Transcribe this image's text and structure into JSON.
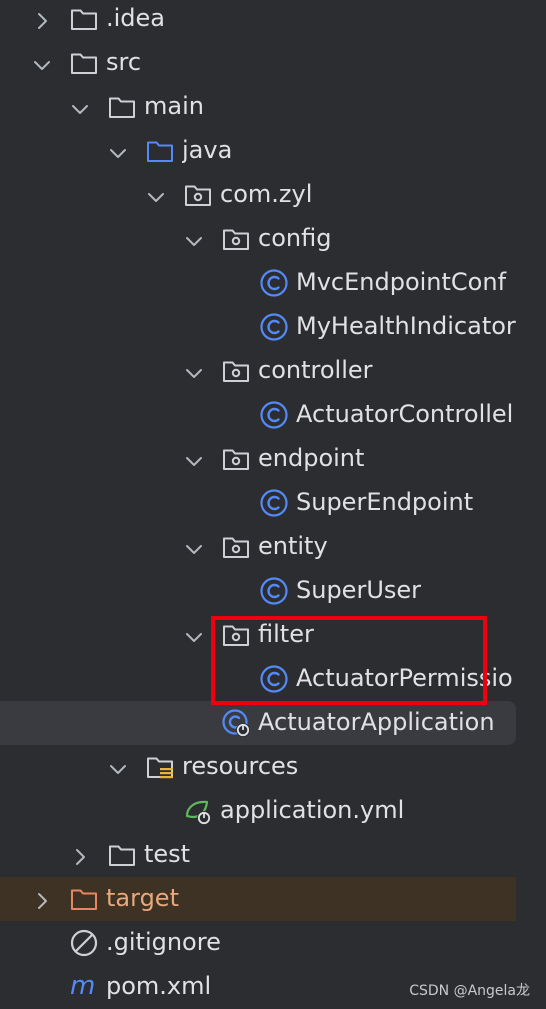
{
  "tree": {
    "items": [
      {
        "label": ".idea",
        "icon": "folder-icon",
        "chevron": "right",
        "level": 1
      },
      {
        "label": "src",
        "icon": "folder-icon",
        "chevron": "down",
        "level": 1
      },
      {
        "label": "main",
        "icon": "folder-icon",
        "chevron": "down",
        "level": 2
      },
      {
        "label": "java",
        "icon": "source-folder-icon",
        "chevron": "down",
        "level": 3
      },
      {
        "label": "com.zyl",
        "icon": "package-icon",
        "chevron": "down",
        "level": 4
      },
      {
        "label": "config",
        "icon": "package-icon",
        "chevron": "down",
        "level": 5
      },
      {
        "label": "MvcEndpointConf",
        "icon": "class-icon",
        "chevron": "none",
        "level": 6
      },
      {
        "label": "MyHealthIndicator",
        "icon": "class-icon",
        "chevron": "none",
        "level": 6
      },
      {
        "label": "controller",
        "icon": "package-icon",
        "chevron": "down",
        "level": 5
      },
      {
        "label": "ActuatorControllel",
        "icon": "class-icon",
        "chevron": "none",
        "level": 6
      },
      {
        "label": "endpoint",
        "icon": "package-icon",
        "chevron": "down",
        "level": 5
      },
      {
        "label": "SuperEndpoint",
        "icon": "class-icon",
        "chevron": "none",
        "level": 6
      },
      {
        "label": "entity",
        "icon": "package-icon",
        "chevron": "down",
        "level": 5
      },
      {
        "label": "SuperUser",
        "icon": "class-icon",
        "chevron": "none",
        "level": 6
      },
      {
        "label": "filter",
        "icon": "package-icon",
        "chevron": "down",
        "level": 5
      },
      {
        "label": "ActuatorPermissio",
        "icon": "class-icon",
        "chevron": "none",
        "level": 6
      },
      {
        "label": "ActuatorApplication",
        "icon": "spring-boot-class-icon",
        "chevron": "none",
        "level": 5,
        "selected": true
      },
      {
        "label": "resources",
        "icon": "resources-folder-icon",
        "chevron": "down",
        "level": 3
      },
      {
        "label": "application.yml",
        "icon": "spring-config-icon",
        "chevron": "none",
        "level": 4
      },
      {
        "label": "test",
        "icon": "folder-icon",
        "chevron": "right",
        "level": 2
      },
      {
        "label": "target",
        "icon": "excluded-folder-icon",
        "chevron": "right",
        "level": 1,
        "excluded": true
      },
      {
        "label": ".gitignore",
        "icon": "gitignore-icon",
        "chevron": "none",
        "level": 1
      },
      {
        "label": "pom.xml",
        "icon": "maven-icon",
        "chevron": "none",
        "level": 1
      }
    ]
  },
  "colors": {
    "background": "#2b2d30",
    "selection": "#393b40",
    "excluded_row": "#3d3223",
    "excluded_text": "#e8a87c",
    "class_icon": "#548af7",
    "highlight_box": "#f0000f"
  },
  "watermark": "CSDN @Angela龙"
}
